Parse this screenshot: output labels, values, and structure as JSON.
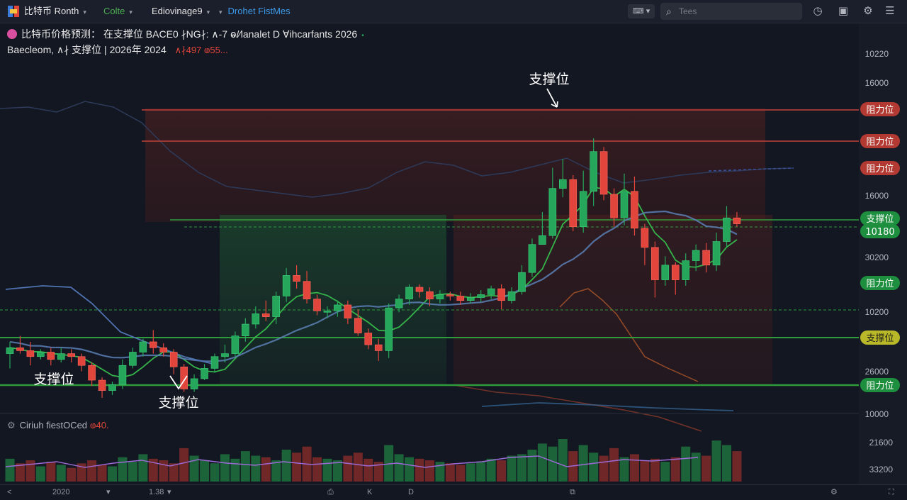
{
  "topbar": {
    "symbol": "比特币 Ronth",
    "timeframe": "Colte",
    "indicators": "Ediovinage9",
    "tool": "Drohet FistMes",
    "kbd": "⌨",
    "search_placeholder": "Tees"
  },
  "legend": {
    "line1": "比特币价格预测： 在支撑位 BACE0 ∤NG∤: ∧-7 ⱺ/∕lanalet D ∀ihcarfants  2026",
    "line2": "Baecleom, ∧∤ 支撑位 | 2026年 2024",
    "line2_values": "∧∤497 ⱷ55..."
  },
  "volume_label": "Ciriuh fiestOCed",
  "volume_value": "ⱷ40.",
  "bottombar": {
    "nav_left": "<",
    "year": "2020",
    "zoom": "1.38",
    "c1": "K",
    "c2": "D"
  },
  "colors": {
    "up": "#26a65b",
    "down": "#e2453c",
    "support": "#2e9c3c",
    "resistance": "#c0403a",
    "bg": "#131722"
  },
  "chart_data": {
    "type": "candlestick",
    "price_axis_ticks": [
      "10220",
      "16000",
      "16000",
      "30200",
      "10200",
      "26000",
      "10000"
    ],
    "volume_axis_ticks": [
      "21600",
      "33200"
    ],
    "axis_labels": [
      {
        "text": "阻力位",
        "kind": "resistance"
      },
      {
        "text": "阻力位",
        "kind": "resistance"
      },
      {
        "text": "阻力位",
        "kind": "resistance"
      },
      {
        "text": "支撑位",
        "kind": "support"
      },
      {
        "text": "10180",
        "kind": "support"
      },
      {
        "text": "阻力位",
        "kind": "support"
      },
      {
        "text": "支撑位",
        "kind": "highlight"
      },
      {
        "text": "阻力位",
        "kind": "support"
      }
    ],
    "annotations": [
      "支撑位",
      "支撑位",
      "支撑位"
    ],
    "candles": [
      [
        100,
        104,
        108,
        90
      ],
      [
        104,
        102,
        112,
        100
      ],
      [
        102,
        98,
        108,
        92
      ],
      [
        98,
        101,
        103,
        96
      ],
      [
        101,
        96,
        104,
        92
      ],
      [
        96,
        100,
        104,
        94
      ],
      [
        100,
        98,
        103,
        94
      ],
      [
        98,
        92,
        100,
        88
      ],
      [
        92,
        82,
        94,
        78
      ],
      [
        82,
        75,
        84,
        70
      ],
      [
        75,
        79,
        81,
        72
      ],
      [
        79,
        92,
        96,
        76
      ],
      [
        92,
        101,
        104,
        90
      ],
      [
        101,
        108,
        110,
        98
      ],
      [
        108,
        104,
        116,
        100
      ],
      [
        104,
        101,
        107,
        98
      ],
      [
        101,
        91,
        103,
        86
      ],
      [
        91,
        76,
        93,
        74
      ],
      [
        76,
        83,
        86,
        74
      ],
      [
        83,
        90,
        93,
        82
      ],
      [
        90,
        98,
        100,
        87
      ],
      [
        98,
        100,
        106,
        94
      ],
      [
        100,
        112,
        115,
        98
      ],
      [
        112,
        120,
        124,
        108
      ],
      [
        120,
        127,
        132,
        117
      ],
      [
        127,
        125,
        136,
        122
      ],
      [
        125,
        139,
        142,
        120
      ],
      [
        139,
        153,
        158,
        135
      ],
      [
        153,
        149,
        160,
        144
      ],
      [
        149,
        137,
        156,
        134
      ],
      [
        137,
        129,
        140,
        126
      ],
      [
        129,
        129,
        132,
        124
      ],
      [
        129,
        133,
        136,
        125
      ],
      [
        133,
        124,
        136,
        120
      ],
      [
        124,
        114,
        130,
        112
      ],
      [
        114,
        106,
        117,
        103
      ],
      [
        106,
        102,
        110,
        95
      ],
      [
        102,
        131,
        134,
        97
      ],
      [
        131,
        137,
        140,
        128
      ],
      [
        137,
        145,
        147,
        133
      ],
      [
        145,
        142,
        147,
        138
      ],
      [
        142,
        137,
        145,
        132
      ],
      [
        137,
        140,
        143,
        134
      ],
      [
        140,
        139,
        142,
        136
      ],
      [
        139,
        136,
        142,
        133
      ],
      [
        136,
        138,
        141,
        134
      ],
      [
        138,
        140,
        143,
        135
      ],
      [
        140,
        144,
        146,
        137
      ],
      [
        144,
        136,
        147,
        130
      ],
      [
        136,
        142,
        145,
        134
      ],
      [
        142,
        155,
        160,
        140
      ],
      [
        155,
        174,
        178,
        152
      ],
      [
        174,
        180,
        196,
        175
      ],
      [
        180,
        212,
        226,
        178
      ],
      [
        212,
        218,
        232,
        206
      ],
      [
        218,
        186,
        221,
        183
      ],
      [
        186,
        210,
        224,
        182
      ],
      [
        210,
        237,
        246,
        200
      ],
      [
        237,
        208,
        240,
        204
      ],
      [
        208,
        192,
        212,
        186
      ],
      [
        192,
        210,
        222,
        187
      ],
      [
        210,
        185,
        220,
        180
      ],
      [
        185,
        172,
        188,
        160
      ],
      [
        172,
        150,
        176,
        138
      ],
      [
        150,
        160,
        166,
        146
      ],
      [
        160,
        150,
        162,
        140
      ],
      [
        150,
        163,
        168,
        146
      ],
      [
        163,
        170,
        174,
        156
      ],
      [
        170,
        160,
        175,
        155
      ],
      [
        160,
        176,
        182,
        156
      ],
      [
        176,
        192,
        200,
        172
      ],
      [
        192,
        188,
        196,
        186
      ]
    ],
    "volumes": [
      15,
      12,
      14,
      10,
      13,
      11,
      9,
      12,
      14,
      11,
      10,
      16,
      13,
      18,
      15,
      14,
      12,
      22,
      17,
      14,
      12,
      18,
      15,
      20,
      17,
      16,
      14,
      21,
      19,
      23,
      16,
      15,
      14,
      17,
      19,
      15,
      13,
      24,
      18,
      16,
      15,
      14,
      13,
      12,
      11,
      12,
      13,
      15,
      14,
      17,
      18,
      21,
      25,
      23,
      28,
      20,
      24,
      19,
      17,
      22,
      16,
      18,
      14,
      15,
      13,
      16,
      23,
      19,
      17,
      27,
      24,
      20
    ]
  }
}
